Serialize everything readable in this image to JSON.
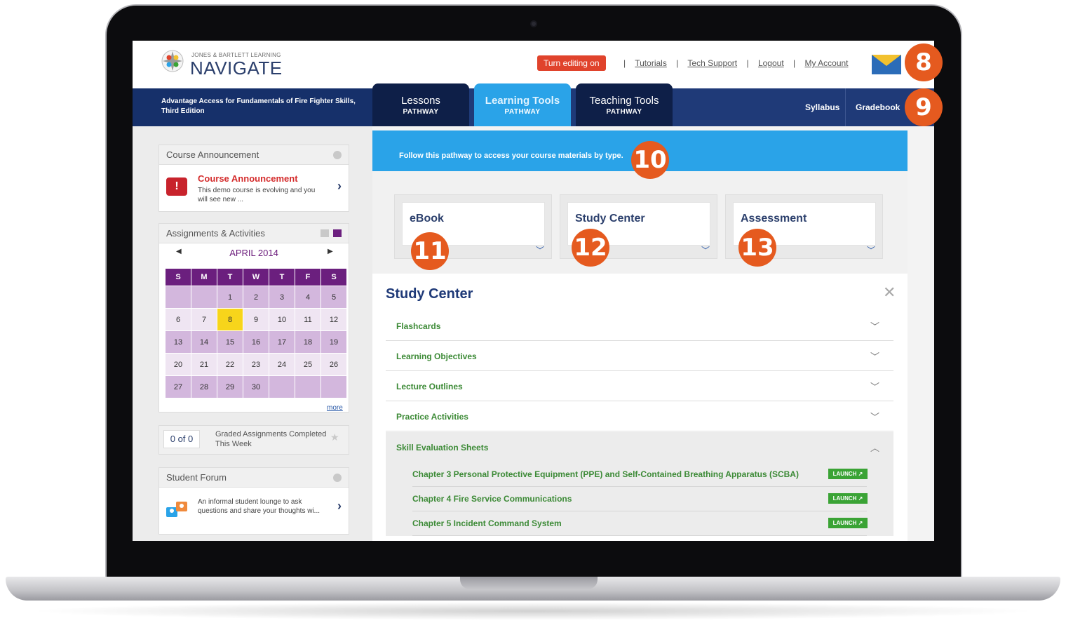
{
  "brand": {
    "small": "JONES & BARTLETT LEARNING",
    "name": "NAVIGATE"
  },
  "topbar": {
    "edit_button": "Turn editing on",
    "links": [
      "Tutorials",
      "Tech Support",
      "Logout",
      "My Account"
    ],
    "mail_icon": "envelope-icon"
  },
  "navbar": {
    "course_title": "Advantage Access for Fundamentals of Fire Fighter Skills, Third Edition",
    "tabs": [
      {
        "label": "Lessons",
        "sub": "PATHWAY"
      },
      {
        "label": "Learning Tools",
        "sub": "PATHWAY"
      },
      {
        "label": "Teaching Tools",
        "sub": "PATHWAY"
      }
    ],
    "syllabus": "Syllabus",
    "gradebook": "Gradebook"
  },
  "sidebar": {
    "announcement": {
      "header": "Course Announcement",
      "title": "Course Announcement",
      "text": "This demo course is evolving and you will see new ..."
    },
    "assignments": {
      "header": "Assignments & Activities",
      "month": "APRIL 2014",
      "weekdays": [
        "S",
        "M",
        "T",
        "W",
        "T",
        "F",
        "S"
      ],
      "weeks": [
        [
          "",
          "",
          "1",
          "2",
          "3",
          "4",
          "5"
        ],
        [
          "6",
          "7",
          "8",
          "9",
          "10",
          "11",
          "12"
        ],
        [
          "13",
          "14",
          "15",
          "16",
          "17",
          "18",
          "19"
        ],
        [
          "20",
          "21",
          "22",
          "23",
          "24",
          "25",
          "26"
        ],
        [
          "27",
          "28",
          "29",
          "30",
          "",
          "",
          ""
        ]
      ],
      "today": "8",
      "more": "more"
    },
    "graded": {
      "count": "0 of 0",
      "text": "Graded Assignments Completed This Week"
    },
    "forum": {
      "header": "Student Forum",
      "text": "An informal student lounge to ask questions and share your thoughts wi..."
    }
  },
  "main": {
    "banner": "Follow this pathway to access your course materials by type.",
    "cards": [
      "eBook",
      "Study Center",
      "Assessment"
    ],
    "study_center": {
      "title": "Study Center",
      "rows": [
        "Flashcards",
        "Learning Objectives",
        "Lecture Outlines",
        "Practice Activities",
        "Skill Evaluation Sheets"
      ],
      "sub_rows": [
        "Chapter 3 Personal Protective Equipment (PPE) and Self-Contained Breathing Apparatus (SCBA)",
        "Chapter 4 Fire Service Communications",
        "Chapter 5 Incident Command System"
      ],
      "launch_label": "LAUNCH ↗"
    }
  },
  "callouts": [
    "8",
    "9",
    "10",
    "11",
    "12",
    "13"
  ],
  "colors": {
    "nav_blue": "#1f3a78",
    "accent_blue": "#2aa3e8",
    "callout_orange": "#e55a1f",
    "calendar_purple": "#6b1f7e",
    "link_green": "#3c8a36"
  }
}
